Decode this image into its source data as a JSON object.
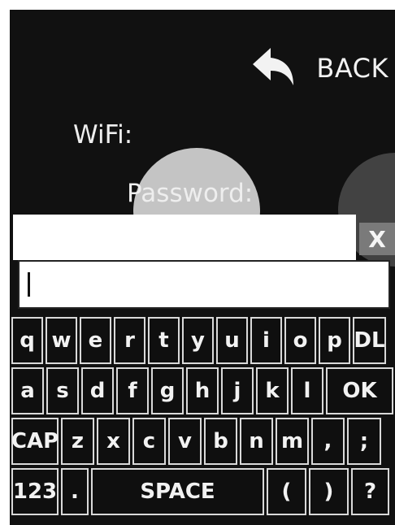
{
  "header": {
    "back_label": "BACK",
    "back_icon": "reply-arrow-icon"
  },
  "labels": {
    "wifi": "WiFi:",
    "password": "Password:"
  },
  "ssid": {
    "clear_label": "X"
  },
  "password": {
    "value": ""
  },
  "keyboard": {
    "row1": [
      "q",
      "w",
      "e",
      "r",
      "t",
      "y",
      "u",
      "i",
      "o",
      "p",
      "DL"
    ],
    "row2": [
      "a",
      "s",
      "d",
      "f",
      "g",
      "h",
      "j",
      "k",
      "l",
      "OK"
    ],
    "row3": [
      "CAP",
      "z",
      "x",
      "c",
      "v",
      "b",
      "n",
      "m",
      ",",
      ";"
    ],
    "row4": [
      "123",
      ".",
      "SPACE",
      "(",
      ")",
      "?"
    ]
  },
  "colors": {
    "background": "#111111",
    "key_border": "#d9d9d9",
    "clear_button": "#7a7a7a"
  }
}
